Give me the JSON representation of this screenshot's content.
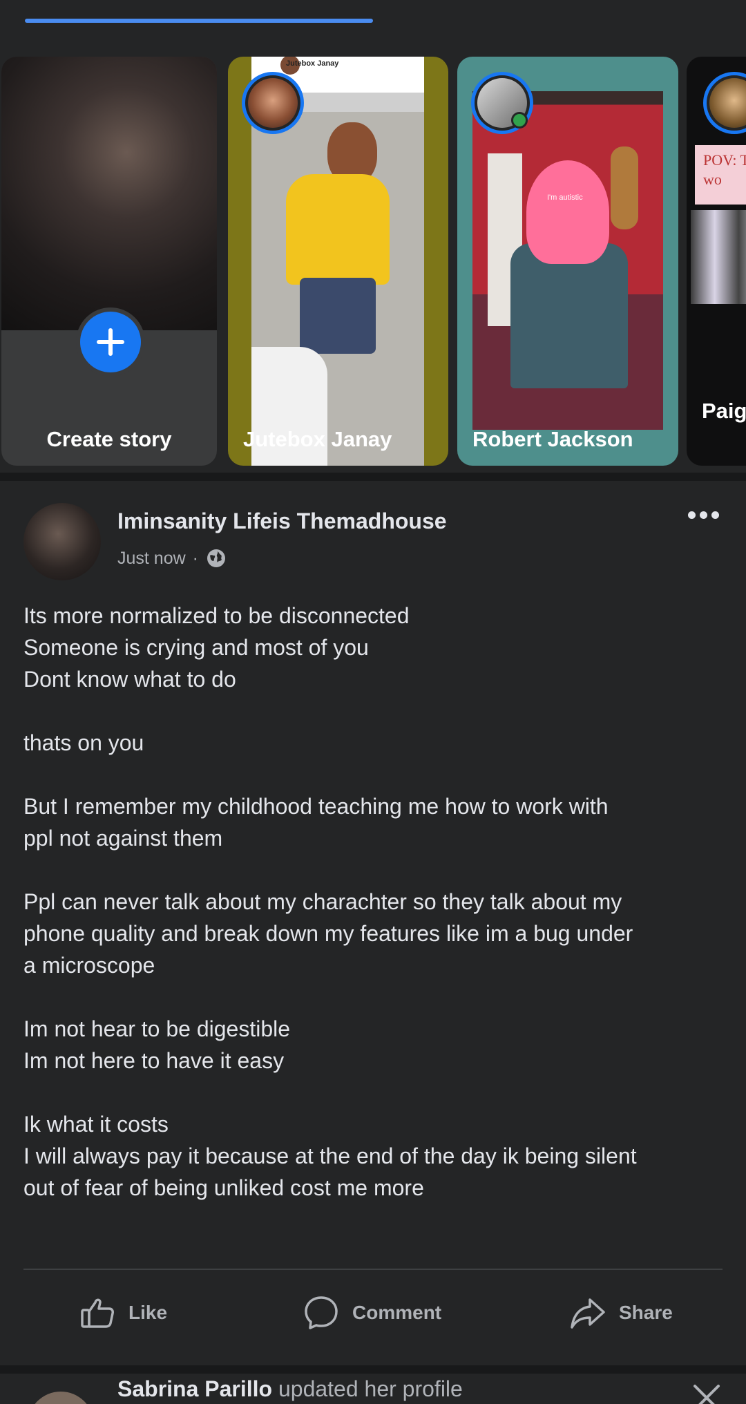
{
  "stories": {
    "create_label": "Create story",
    "items": [
      {
        "name": "Jutebox Janay",
        "overlay_tag": "Jutebox Janay"
      },
      {
        "name": "Robert Jackson",
        "overlay_caption": "I'm autistic"
      },
      {
        "name": "Paig Hem",
        "overlay_text": "POV: T I wo"
      }
    ]
  },
  "post": {
    "author": "Iminsanity Lifeis Themadhouse",
    "time": "Just now",
    "separator": "·",
    "privacy_icon": "globe-icon",
    "lines": [
      "Its more normalized to be disconnected",
      "Someone is crying and most of you",
      "Dont know what to do",
      "",
      "thats on you",
      "",
      "But I remember my childhood teaching me how to work with",
      "ppl not against them",
      "",
      "Ppl can never talk about my charachter so they talk about my",
      "phone quality and break down my features like im a bug under",
      "a microscope",
      "",
      "Im not hear to be digestible",
      "Im not here to have it easy",
      "",
      "Ik what it costs",
      "I will always pay it because at the end of the day ik being silent",
      "out of fear of being unliked cost me more"
    ],
    "actions": {
      "like": "Like",
      "comment": "Comment",
      "share": "Share"
    }
  },
  "next_post": {
    "author": "Sabrina Parillo",
    "activity": "updated her profile"
  },
  "colors": {
    "background": "#242526",
    "divider": "#18191a",
    "accent": "#1877f2",
    "text_primary": "#e4e6eb",
    "text_secondary": "#b0b3b8"
  }
}
